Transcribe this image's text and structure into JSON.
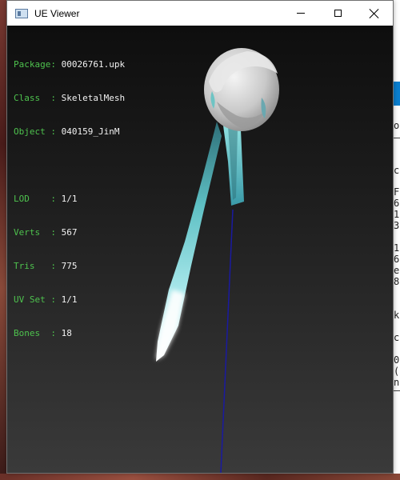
{
  "window": {
    "title": "UE Viewer"
  },
  "viewer": {
    "object_info": [
      {
        "key": "Package",
        "value": "00026761.upk"
      },
      {
        "key": "Class  ",
        "value": "SkeletalMesh"
      },
      {
        "key": "Object ",
        "value": "040159_JinM"
      }
    ],
    "mesh_info": [
      {
        "key": "LOD    ",
        "value": "1/1"
      },
      {
        "key": "Verts  ",
        "value": "567"
      },
      {
        "key": "Tris   ",
        "value": "775"
      },
      {
        "key": "UV Set ",
        "value": "1/1"
      },
      {
        "key": "Bones  ",
        "value": "18"
      }
    ],
    "colors": {
      "label": "#4ec24e",
      "value": "#f2f2f2",
      "bone_line": "#1a1aa0",
      "ribbon": "#5ec8c8"
    }
  },
  "background_window": {
    "fragments": [
      "o",
      "c",
      "F",
      "6",
      "1",
      "3",
      "1",
      "6",
      "e",
      "8",
      "k",
      "c",
      "0",
      "(",
      "n"
    ]
  }
}
